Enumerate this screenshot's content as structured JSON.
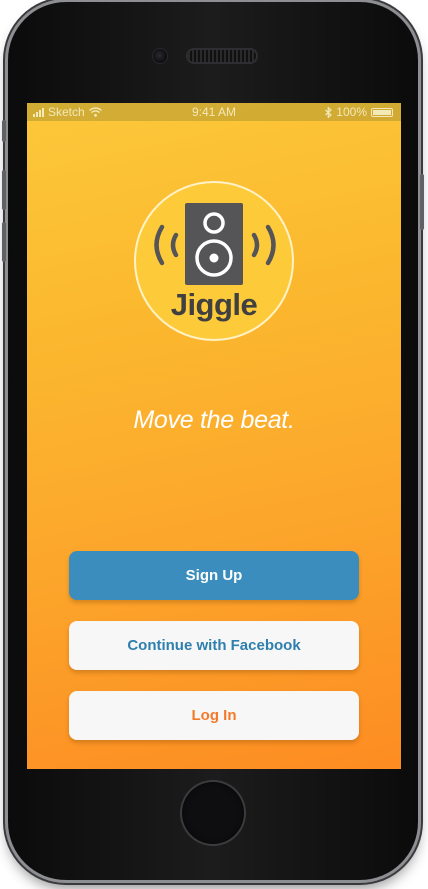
{
  "status_bar": {
    "carrier": "Sketch",
    "time": "9:41 AM",
    "battery": "100%"
  },
  "logo": {
    "name": "Jiggle"
  },
  "tagline": "Move the beat.",
  "buttons": {
    "sign_up": "Sign Up",
    "facebook": "Continue with Facebook",
    "log_in": "Log In"
  },
  "colors": {
    "gradient_top": "#fdc83a",
    "gradient_bottom": "#fd8c22",
    "primary_button": "#3a8dbd",
    "facebook_text": "#2f7fae",
    "login_text": "#f47a2a",
    "logo_dark": "#555457"
  }
}
